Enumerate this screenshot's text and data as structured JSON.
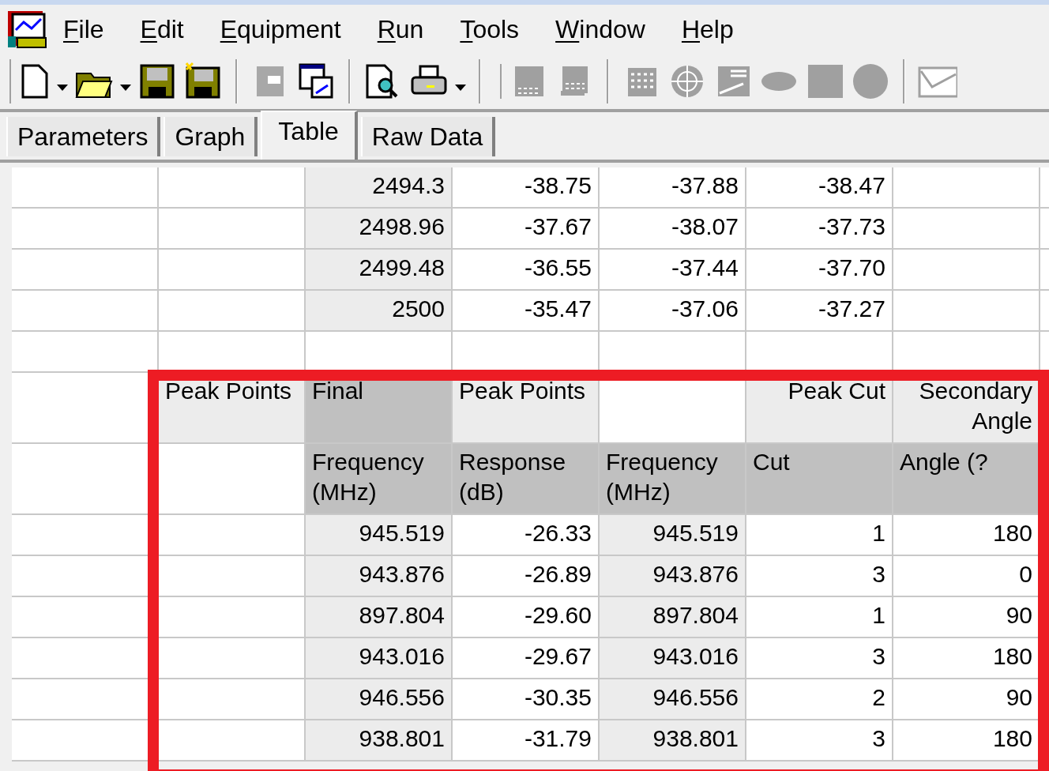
{
  "menu_bar": {
    "items": [
      {
        "label": "File"
      },
      {
        "label": "Edit"
      },
      {
        "label": "Equipment"
      },
      {
        "label": "Run"
      },
      {
        "label": "Tools"
      },
      {
        "label": "Window"
      },
      {
        "label": "Help"
      }
    ]
  },
  "tabs": [
    {
      "label": "Parameters",
      "selected": false
    },
    {
      "label": "Graph",
      "selected": false
    },
    {
      "label": "Table",
      "selected": true
    },
    {
      "label": "Raw Data",
      "selected": false
    }
  ],
  "table": {
    "rows": [
      {
        "kind": "data",
        "column_3": "2494.3",
        "column_4": "-38.75",
        "column_5": "-37.88",
        "column_6": "-38.47"
      },
      {
        "kind": "data",
        "column_3": "2498.96",
        "column_4": "-37.67",
        "column_5": "-38.07",
        "column_6": "-37.73"
      },
      {
        "kind": "data",
        "column_3": "2499.48",
        "column_4": "-36.55",
        "column_5": "-37.44",
        "column_6": "-37.70"
      },
      {
        "kind": "data",
        "column_3": "2500",
        "column_4": "-35.47",
        "column_5": "-37.06",
        "column_6": "-37.27"
      },
      {
        "kind": "blank"
      },
      {
        "kind": "header_top",
        "column_2": "Peak Points",
        "column_3": "Final",
        "column_4": "Peak Points",
        "column_6": "Peak Cut",
        "column_7": "Secondary Angle"
      },
      {
        "kind": "header_sub",
        "column_3": "Frequency (MHz)",
        "column_4": "Response (dB)",
        "column_5": "Frequency (MHz)",
        "column_6": "Cut",
        "column_7": "Angle (?"
      },
      {
        "kind": "result",
        "column_3": "945.519",
        "column_4": "-26.33",
        "column_5": "945.519",
        "column_6": "1",
        "column_7": "180"
      },
      {
        "kind": "result",
        "column_3": "943.876",
        "column_4": "-26.89",
        "column_5": "943.876",
        "column_6": "3",
        "column_7": "0"
      },
      {
        "kind": "result",
        "column_3": "897.804",
        "column_4": "-29.60",
        "column_5": "897.804",
        "column_6": "1",
        "column_7": "90"
      },
      {
        "kind": "result",
        "column_3": "943.016",
        "column_4": "-29.67",
        "column_5": "943.016",
        "column_6": "3",
        "column_7": "180"
      },
      {
        "kind": "result",
        "column_3": "946.556",
        "column_4": "-30.35",
        "column_5": "946.556",
        "column_6": "2",
        "column_7": "90"
      },
      {
        "kind": "result",
        "column_3": "938.801",
        "column_4": "-31.79",
        "column_5": "938.801",
        "column_6": "3",
        "column_7": "180"
      }
    ]
  }
}
